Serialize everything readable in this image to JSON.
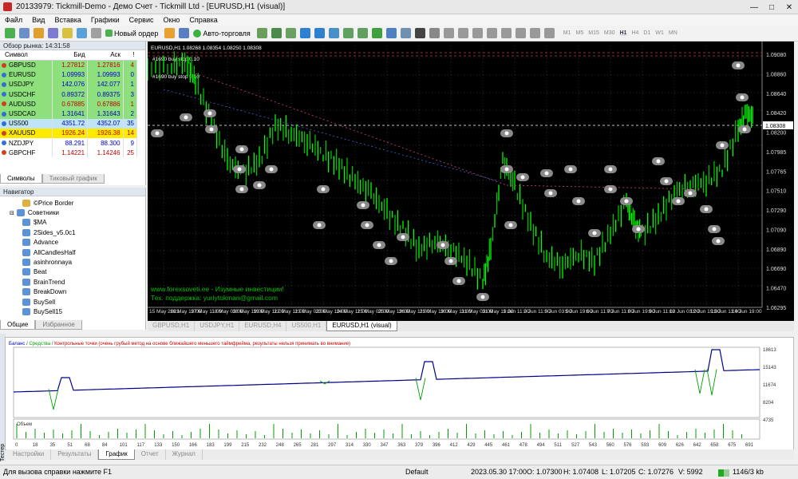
{
  "window": {
    "title": "20133979: Tickmill-Demo - Демо Счет - Tickmill Ltd - [EURUSD,H1 (visual)]"
  },
  "menu": [
    "Файл",
    "Вид",
    "Вставка",
    "Графики",
    "Сервис",
    "Окно",
    "Справка"
  ],
  "toolbar": {
    "new_order": "Новый ордер",
    "autotrading": "Авто-торговля",
    "timeframes": [
      "M1",
      "M5",
      "M15",
      "M30",
      "H1",
      "H4",
      "D1",
      "W1",
      "MN"
    ]
  },
  "market_watch": {
    "title": "Обзор рынка: 14:31:58",
    "headers": {
      "symbol": "Символ",
      "bid": "Бид",
      "ask": "Аск",
      "spread": "!"
    },
    "rows": [
      {
        "symbol": "GBPUSD",
        "bid": "1.27812",
        "ask": "1.27816",
        "spread": "4",
        "bg": "#8ee07c",
        "color": "#c00000"
      },
      {
        "symbol": "EURUSD",
        "bid": "1.09993",
        "ask": "1.09993",
        "spread": "0",
        "bg": "#8ee07c",
        "color": "#0000c0"
      },
      {
        "symbol": "USDJPY",
        "bid": "142.076",
        "ask": "142.077",
        "spread": "1",
        "bg": "#8ee07c",
        "color": "#0000c0"
      },
      {
        "symbol": "USDCHF",
        "bid": "0.89372",
        "ask": "0.89375",
        "spread": "3",
        "bg": "#8ee07c",
        "color": "#0000c0"
      },
      {
        "symbol": "AUDUSD",
        "bid": "0.67885",
        "ask": "0.67886",
        "spread": "1",
        "bg": "#8ee07c",
        "color": "#c00000"
      },
      {
        "symbol": "USDCAD",
        "bid": "1.31641",
        "ask": "1.31643",
        "spread": "2",
        "bg": "#8ee07c",
        "color": "#0000c0"
      },
      {
        "symbol": "US500",
        "bid": "4351.72",
        "ask": "4352.07",
        "spread": "35",
        "bg": "#bfe4f7",
        "color": "#0000c0"
      },
      {
        "symbol": "XAUUSD",
        "bid": "1926.24",
        "ask": "1926.38",
        "spread": "14",
        "bg": "#ffea00",
        "color": "#c00000"
      },
      {
        "symbol": "NZDJPY",
        "bid": "88.291",
        "ask": "88.300",
        "spread": "9",
        "bg": "#ffffff",
        "color": "#0000c0"
      },
      {
        "symbol": "GBPCHF",
        "bid": "1.14221",
        "ask": "1.14246",
        "spread": "25",
        "bg": "#ffffff",
        "color": "#c00000"
      }
    ],
    "tabs": [
      "Символы",
      "Тиковый график"
    ]
  },
  "navigator": {
    "title": "Навигатор",
    "items": [
      {
        "label": "©Price Border",
        "indent": 1
      },
      {
        "label": "Советники",
        "indent": 0
      },
      {
        "label": "$MA",
        "indent": 1
      },
      {
        "label": "2Sides_v5.0c1",
        "indent": 1
      },
      {
        "label": "Advance",
        "indent": 1
      },
      {
        "label": "AllCandlesHalf",
        "indent": 1
      },
      {
        "label": "asinhronnaya",
        "indent": 1
      },
      {
        "label": "Beat",
        "indent": 1
      },
      {
        "label": "BrainTrend",
        "indent": 1
      },
      {
        "label": "BreakDown",
        "indent": 1
      },
      {
        "label": "BuySell",
        "indent": 1
      },
      {
        "label": "BuySell15",
        "indent": 1
      }
    ],
    "tabs": [
      "Общие",
      "Избранное"
    ]
  },
  "chart": {
    "header": "EURUSD,H1  1.08268 1.08354 1.08250 1.08308",
    "annotations": [
      "#1690 buy stop 0.10",
      "#1690 buy stop 0.10"
    ],
    "watermark": [
      "www.forexsoveti.ee - Изумные инвестиции!",
      "Тех. поддержка: yuriytokman@gmail.com"
    ],
    "current_price": "1.08308",
    "price_ticks": [
      "1.09080",
      "1.08860",
      "1.08640",
      "1.08420",
      "1.08200",
      "1.07985",
      "1.07765",
      "1.07510",
      "1.07290",
      "1.07090",
      "1.06890",
      "1.06690",
      "1.06470",
      "1.06295"
    ],
    "time_ticks": [
      "15 May 2023",
      "16 May 19:00",
      "17 May 11:00",
      "18 May 03:00",
      "18 May 19:00",
      "19 May 11:00",
      "22 May 11:00",
      "23 May 03:00",
      "23 May 19:00",
      "24 May 11:00",
      "25 May 03:00",
      "25 May 19:00",
      "26 May 11:00",
      "29 May 19:00",
      "30 May 11:00",
      "31 May 03:00",
      "31 May 19:00",
      "1 Jun 11:00",
      "2 Jun 11:00",
      "5 Jun 03:00",
      "5 Jun 19:00",
      "6 Jun 11:00",
      "7 Jun 11:00",
      "8 Jun 19:00",
      "9 Jun 11:00",
      "12 Jun 03:00",
      "12 Jun 19:00",
      "13 Jun 11:00",
      "14 Jun 19:00"
    ],
    "colors": {
      "bull": "#00ff00",
      "bear": "#00c000",
      "bg": "#000000"
    }
  },
  "chart_tabs": [
    "GBPUSD,H1",
    "USDJPY,H1",
    "EURUSD,H4",
    "US500,H1",
    "EURUSD,H1 (visual)"
  ],
  "tester": {
    "legend": {
      "balance": "Баланс",
      "equity": "Средства",
      "note": "Контрольные точки (очень грубый метод на основе ближайшего меньшего таймфрейма, результаты нельзя принимать во внимание)"
    },
    "volume_label": "Объем",
    "y_ticks": [
      "18613",
      "15143",
      "11674",
      "8204",
      "4735"
    ],
    "x_ticks": [
      "0",
      "18",
      "35",
      "51",
      "68",
      "84",
      "101",
      "117",
      "133",
      "150",
      "166",
      "183",
      "199",
      "215",
      "232",
      "248",
      "265",
      "281",
      "297",
      "314",
      "330",
      "347",
      "363",
      "379",
      "396",
      "412",
      "429",
      "445",
      "461",
      "478",
      "494",
      "511",
      "527",
      "543",
      "560",
      "576",
      "593",
      "609",
      "626",
      "642",
      "658",
      "675",
      "691"
    ],
    "side_label": "Тестер",
    "tabs": [
      "Настройки",
      "Результаты",
      "График",
      "Отчет",
      "Журнал"
    ]
  },
  "status": {
    "help": "Для вызова справки нажмите F1",
    "profile": "Default",
    "time": "2023.05.30 17:00",
    "open": "O: 1.07300",
    "high": "H: 1.07408",
    "low": "L: 1.07205",
    "close": "C: 1.07276",
    "volume": "V: 5992",
    "traffic": "1146/3 kb"
  }
}
